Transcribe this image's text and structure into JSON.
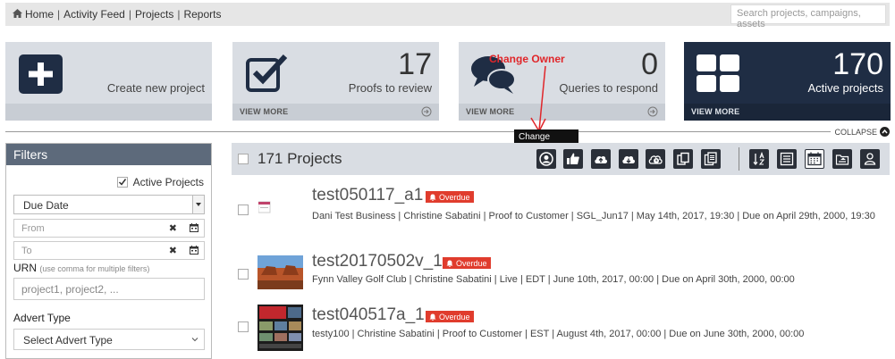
{
  "nav": {
    "home": "Home",
    "sep1": "|",
    "activity": "Activity Feed",
    "sep2": "|",
    "projects": "Projects",
    "sep3": "|",
    "reports": "Reports",
    "search_placeholder": "Search projects, campaigns, assets"
  },
  "tiles": {
    "create": {
      "label": "Create new project"
    },
    "proofs": {
      "count": "17",
      "label": "Proofs to review",
      "view_more": "VIEW MORE"
    },
    "queries": {
      "count": "0",
      "label": "Queries to respond",
      "view_more": "VIEW MORE"
    },
    "active": {
      "count": "170",
      "label": "Active projects",
      "view_more": "VIEW MORE"
    }
  },
  "collapse": "COLLAPSE",
  "annotation": "Change Owner",
  "tooltip": "Change owner",
  "filters": {
    "title": "Filters",
    "active_projects": "Active Projects",
    "sort_select": "Due Date",
    "from_placeholder": "From",
    "to_placeholder": "To",
    "clear_glyph": "✖",
    "urn_label": "URN",
    "urn_hint": "(use comma for multiple filters)",
    "urn_placeholder": "project1, project2, ...",
    "advert_label": "Advert Type",
    "advert_select": "Select Advert Type"
  },
  "projects_bar": {
    "title": "171 Projects"
  },
  "projects": [
    {
      "name": "test050117_a1",
      "badge": "Overdue",
      "meta": "Dani Test Business | Christine Sabatini | Proof to Customer | SGL_Jun17 | May 14th, 2017, 19:30 | Due on April 29th, 2000, 19:30"
    },
    {
      "name": "test20170502v_1",
      "badge": "Overdue",
      "meta": "Fynn Valley Golf Club | Christine Sabatini | Live | EDT | June 10th, 2017, 00:00 | Due on April 30th, 2000, 00:00"
    },
    {
      "name": "test040517a_1",
      "badge": "Overdue",
      "meta": "testy100 | Christine Sabatini | Proof to Customer | EST | August 4th, 2017, 00:00 | Due on June 30th, 2000, 00:00"
    }
  ],
  "colors": {
    "accent_dark": "#1f2d44",
    "tile_bg": "#d9dde3",
    "overdue": "#e03c2d",
    "annotation": "#e0262a"
  }
}
